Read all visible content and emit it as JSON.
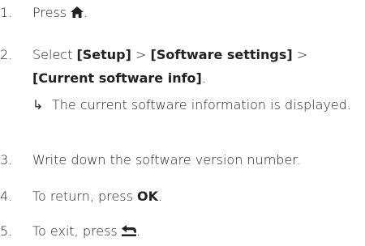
{
  "steps": [
    {
      "num": "1.",
      "prefix": "Press",
      "icon": "home-icon",
      "suffix": "."
    },
    {
      "num": "2.",
      "prefix": "Select",
      "menu1": "[Setup]",
      "sep1": ">",
      "menu2": "[Software settings]",
      "sep2": ">",
      "menu3": "[Current software info]",
      "suffix": "."
    },
    {
      "num": "3.",
      "text": "Write down the software version number."
    },
    {
      "num": "4.",
      "prefix": "To return, press",
      "key": "OK",
      "suffix": "."
    },
    {
      "num": "5.",
      "prefix": "To exit, press",
      "icon": "back-icon",
      "suffix": "."
    }
  ],
  "result": {
    "arrow": "↳",
    "text": "The current software information is displayed."
  }
}
